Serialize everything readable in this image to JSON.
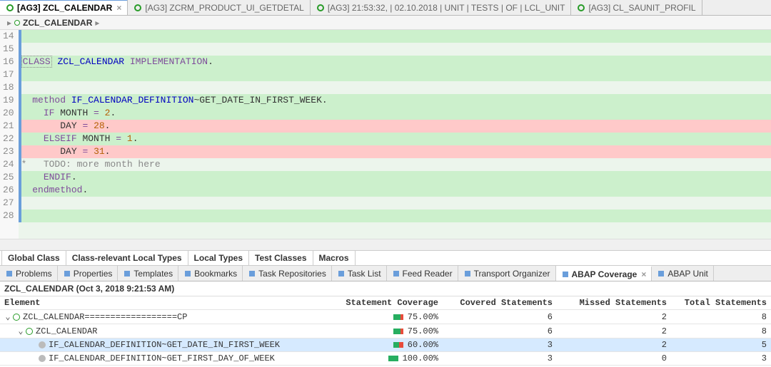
{
  "editor_tabs": [
    {
      "label": "[AG3] ZCL_CALENDAR",
      "active": true,
      "icon": "class-icon"
    },
    {
      "label": "[AG3] ZCRM_PRODUCT_UI_GETDETAL",
      "active": false,
      "icon": "class-icon"
    },
    {
      "label": "[AG3] 21:53:32, | 02.10.2018 | UNIT | TESTS | OF | LCL_UNIT",
      "active": false,
      "icon": "file-icon"
    },
    {
      "label": "[AG3] CL_SAUNIT_PROFIL",
      "active": false,
      "icon": "class-icon"
    }
  ],
  "breadcrumb": {
    "root": "ZCL_CALENDAR"
  },
  "code_lines": [
    {
      "n": 14,
      "cov": "green",
      "raw": ""
    },
    {
      "n": 15,
      "cov": "none",
      "raw": ""
    },
    {
      "n": 16,
      "cov": "green",
      "tokens": [
        [
          "sel",
          "CLASS"
        ],
        [
          "txt",
          " "
        ],
        [
          "cls",
          "ZCL_CALENDAR"
        ],
        [
          "txt",
          " "
        ],
        [
          "kw",
          "IMPLEMENTATION"
        ],
        [
          "txt",
          "."
        ]
      ]
    },
    {
      "n": 17,
      "cov": "green",
      "raw": ""
    },
    {
      "n": 18,
      "cov": "none",
      "raw": ""
    },
    {
      "n": 19,
      "cov": "green",
      "tokens": [
        [
          "txt",
          "  "
        ],
        [
          "kw",
          "method"
        ],
        [
          "txt",
          " "
        ],
        [
          "cls",
          "IF_CALENDAR_DEFINITION"
        ],
        [
          "txt",
          "~GET_DATE_IN_FIRST_WEEK."
        ]
      ]
    },
    {
      "n": 20,
      "cov": "green",
      "tokens": [
        [
          "txt",
          "    "
        ],
        [
          "kw",
          "IF"
        ],
        [
          "txt",
          " MONTH "
        ],
        [
          "kw",
          "="
        ],
        [
          "txt",
          " "
        ],
        [
          "num",
          "2"
        ],
        [
          "txt",
          "."
        ]
      ]
    },
    {
      "n": 21,
      "cov": "red",
      "tokens": [
        [
          "txt",
          "       DAY "
        ],
        [
          "kw",
          "="
        ],
        [
          "txt",
          " "
        ],
        [
          "num",
          "28"
        ],
        [
          "txt",
          "."
        ]
      ]
    },
    {
      "n": 22,
      "cov": "green",
      "tokens": [
        [
          "txt",
          "    "
        ],
        [
          "kw",
          "ELSEIF"
        ],
        [
          "txt",
          " MONTH "
        ],
        [
          "kw",
          "="
        ],
        [
          "txt",
          " "
        ],
        [
          "num",
          "1"
        ],
        [
          "txt",
          "."
        ]
      ]
    },
    {
      "n": 23,
      "cov": "red",
      "tokens": [
        [
          "txt",
          "       DAY "
        ],
        [
          "kw",
          "="
        ],
        [
          "txt",
          " "
        ],
        [
          "num",
          "31"
        ],
        [
          "txt",
          "."
        ]
      ]
    },
    {
      "n": 24,
      "cov": "none",
      "tokens": [
        [
          "cmt",
          "*   TODO: more month here"
        ]
      ]
    },
    {
      "n": 25,
      "cov": "green",
      "tokens": [
        [
          "txt",
          "    "
        ],
        [
          "kw",
          "ENDIF"
        ],
        [
          "txt",
          "."
        ]
      ]
    },
    {
      "n": 26,
      "cov": "green",
      "tokens": [
        [
          "txt",
          "  "
        ],
        [
          "kw",
          "endmethod"
        ],
        [
          "txt",
          "."
        ]
      ]
    },
    {
      "n": 27,
      "cov": "none",
      "raw": ""
    },
    {
      "n": 28,
      "cov": "green",
      "raw": ""
    }
  ],
  "source_tabs": [
    "Global Class",
    "Class-relevant Local Types",
    "Local Types",
    "Test Classes",
    "Macros"
  ],
  "view_tabs": [
    {
      "label": "Problems"
    },
    {
      "label": "Properties"
    },
    {
      "label": "Templates"
    },
    {
      "label": "Bookmarks"
    },
    {
      "label": "Task Repositories"
    },
    {
      "label": "Task List"
    },
    {
      "label": "Feed Reader"
    },
    {
      "label": "Transport Organizer"
    },
    {
      "label": "ABAP Coverage",
      "active": true
    },
    {
      "label": "ABAP Unit"
    }
  ],
  "coverage": {
    "title": "ZCL_CALENDAR (Oct 3, 2018 9:21:53 AM)",
    "columns": {
      "element": "Element",
      "stmt": "Statement Coverage",
      "covered": "Covered Statements",
      "missed": "Missed Statements",
      "total": "Total Statements"
    },
    "rows": [
      {
        "indent": 0,
        "expand": true,
        "icon": "cls2",
        "name": "ZCL_CALENDAR==================CP",
        "pct": "75.00%",
        "cov": 6,
        "miss": 2,
        "tot": 8,
        "fill": 75
      },
      {
        "indent": 1,
        "expand": true,
        "icon": "cls2",
        "name": "ZCL_CALENDAR",
        "pct": "75.00%",
        "cov": 6,
        "miss": 2,
        "tot": 8,
        "fill": 75
      },
      {
        "indent": 2,
        "expand": false,
        "icon": "leaf",
        "name": "IF_CALENDAR_DEFINITION~GET_DATE_IN_FIRST_WEEK",
        "pct": "60.00%",
        "cov": 3,
        "miss": 2,
        "tot": 5,
        "fill": 60,
        "selected": true
      },
      {
        "indent": 2,
        "expand": false,
        "icon": "leaf",
        "name": "IF_CALENDAR_DEFINITION~GET_FIRST_DAY_OF_WEEK",
        "pct": "100.00%",
        "cov": 3,
        "miss": 0,
        "tot": 3,
        "fill": 100
      }
    ]
  },
  "chart_data": {
    "type": "table",
    "title": "ZCL_CALENDAR (Oct 3, 2018 9:21:53 AM)",
    "columns": [
      "Element",
      "Statement Coverage",
      "Covered Statements",
      "Missed Statements",
      "Total Statements"
    ],
    "rows": [
      [
        "ZCL_CALENDAR==================CP",
        75.0,
        6,
        2,
        8
      ],
      [
        "ZCL_CALENDAR",
        75.0,
        6,
        2,
        8
      ],
      [
        "IF_CALENDAR_DEFINITION~GET_DATE_IN_FIRST_WEEK",
        60.0,
        3,
        2,
        5
      ],
      [
        "IF_CALENDAR_DEFINITION~GET_FIRST_DAY_OF_WEEK",
        100.0,
        3,
        0,
        3
      ]
    ]
  }
}
